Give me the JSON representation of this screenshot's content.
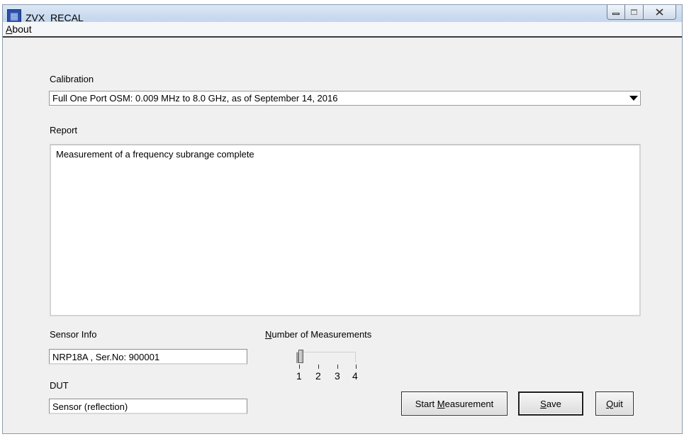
{
  "window": {
    "title": "ZVX_RECAL",
    "app_icon": "maze-icon"
  },
  "menu": {
    "about": {
      "mnemonic": "A",
      "rest": "bout"
    }
  },
  "calibration": {
    "label": "Calibration",
    "selected": "Full One Port OSM:  0.009 MHz to 8.0 GHz, as of September 14, 2016"
  },
  "report": {
    "label": "Report",
    "text": "Measurement of a frequency subrange complete"
  },
  "sensor_info": {
    "label": "Sensor Info",
    "value": "NRP18A , Ser.No: 900001"
  },
  "dut": {
    "label": "DUT",
    "value": "Sensor (reflection)"
  },
  "measurements": {
    "label_mnemonic": "N",
    "label_rest": "umber of Measurements",
    "ticks": [
      "1",
      "2",
      "3",
      "4"
    ],
    "selected": "1"
  },
  "buttons": {
    "start": {
      "before": "Start ",
      "mnemonic": "M",
      "after": "easurement"
    },
    "save": {
      "mnemonic": "S",
      "after": "ave"
    },
    "quit": {
      "mnemonic": "Q",
      "after": "uit"
    }
  }
}
